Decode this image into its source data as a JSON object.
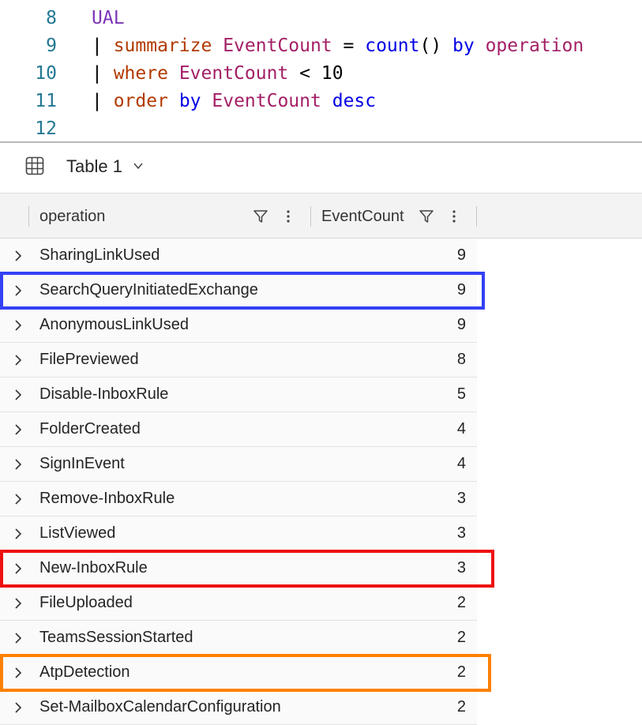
{
  "editor": {
    "lines": [
      {
        "num": "8",
        "tokens": [
          {
            "text": "UAL",
            "cls": "t-table"
          }
        ]
      },
      {
        "num": "9",
        "tokens": [
          {
            "text": "| ",
            "cls": "t-pipe"
          },
          {
            "text": "summarize",
            "cls": "t-kw"
          },
          {
            "text": " ",
            "cls": "t-op"
          },
          {
            "text": "EventCount",
            "cls": "t-col"
          },
          {
            "text": " = ",
            "cls": "t-op"
          },
          {
            "text": "count",
            "cls": "t-fn"
          },
          {
            "text": "() ",
            "cls": "t-op"
          },
          {
            "text": "by",
            "cls": "t-fn"
          },
          {
            "text": " ",
            "cls": "t-op"
          },
          {
            "text": "operation",
            "cls": "t-col"
          }
        ]
      },
      {
        "num": "10",
        "tokens": [
          {
            "text": "| ",
            "cls": "t-pipe"
          },
          {
            "text": "where",
            "cls": "t-kw"
          },
          {
            "text": " ",
            "cls": "t-op"
          },
          {
            "text": "EventCount",
            "cls": "t-col"
          },
          {
            "text": " < ",
            "cls": "t-op"
          },
          {
            "text": "10",
            "cls": "t-num"
          }
        ]
      },
      {
        "num": "11",
        "tokens": [
          {
            "text": "| ",
            "cls": "t-pipe"
          },
          {
            "text": "order",
            "cls": "t-kw"
          },
          {
            "text": " ",
            "cls": "t-op"
          },
          {
            "text": "by",
            "cls": "t-fn"
          },
          {
            "text": " ",
            "cls": "t-op"
          },
          {
            "text": "EventCount",
            "cls": "t-col"
          },
          {
            "text": " ",
            "cls": "t-op"
          },
          {
            "text": "desc",
            "cls": "t-fn"
          }
        ]
      },
      {
        "num": "12",
        "tokens": []
      }
    ]
  },
  "results": {
    "tab_title": "Table 1",
    "icons": {
      "table": "table-grid-icon",
      "dropdown": "chevron-down-icon",
      "filter": "filter-icon",
      "menu": "more-vertical-icon",
      "expand": "chevron-right-icon"
    },
    "columns": [
      {
        "title": "operation"
      },
      {
        "title": "EventCount"
      }
    ],
    "rows": [
      {
        "operation": "SharingLinkUsed",
        "count": "9"
      },
      {
        "operation": "SearchQueryInitiatedExchange",
        "count": "9",
        "highlight": "#3341f5"
      },
      {
        "operation": "AnonymousLinkUsed",
        "count": "9"
      },
      {
        "operation": "FilePreviewed",
        "count": "8"
      },
      {
        "operation": "Disable-InboxRule",
        "count": "5"
      },
      {
        "operation": "FolderCreated",
        "count": "4"
      },
      {
        "operation": "SignInEvent",
        "count": "4"
      },
      {
        "operation": "Remove-InboxRule",
        "count": "3"
      },
      {
        "operation": "ListViewed",
        "count": "3"
      },
      {
        "operation": "New-InboxRule",
        "count": "3",
        "highlight": "#ee1111"
      },
      {
        "operation": "FileUploaded",
        "count": "2"
      },
      {
        "operation": "TeamsSessionStarted",
        "count": "2"
      },
      {
        "operation": "AtpDetection",
        "count": "2",
        "highlight": "#ff8000"
      },
      {
        "operation": "Set-MailboxCalendarConfiguration",
        "count": "2"
      }
    ]
  }
}
